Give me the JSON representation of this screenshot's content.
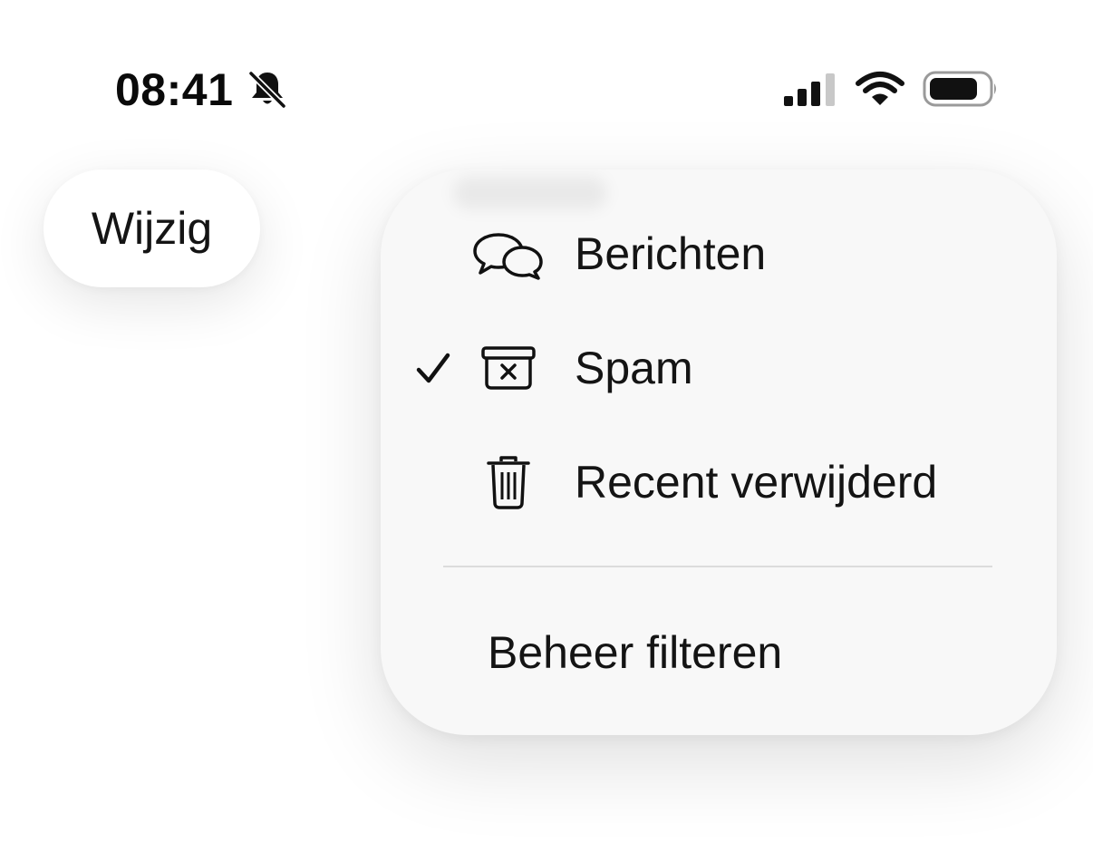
{
  "status_bar": {
    "time": "08:41",
    "silent_icon": "bell-slash-icon",
    "signal_icon": "cellular-signal-icon",
    "wifi_icon": "wifi-icon",
    "battery_icon": "battery-icon"
  },
  "edit_button": {
    "label": "Wijzig"
  },
  "menu": {
    "items": [
      {
        "label": "Berichten",
        "icon": "chat-bubbles-icon",
        "checked": false
      },
      {
        "label": "Spam",
        "icon": "junk-bin-icon",
        "checked": true
      },
      {
        "label": "Recent verwijderd",
        "icon": "trash-icon",
        "checked": false
      }
    ],
    "manage_label": "Beheer filteren"
  },
  "colors": {
    "text": "#141414",
    "menu_background": "#f8f8f8",
    "separator": "#dcdcdc"
  }
}
